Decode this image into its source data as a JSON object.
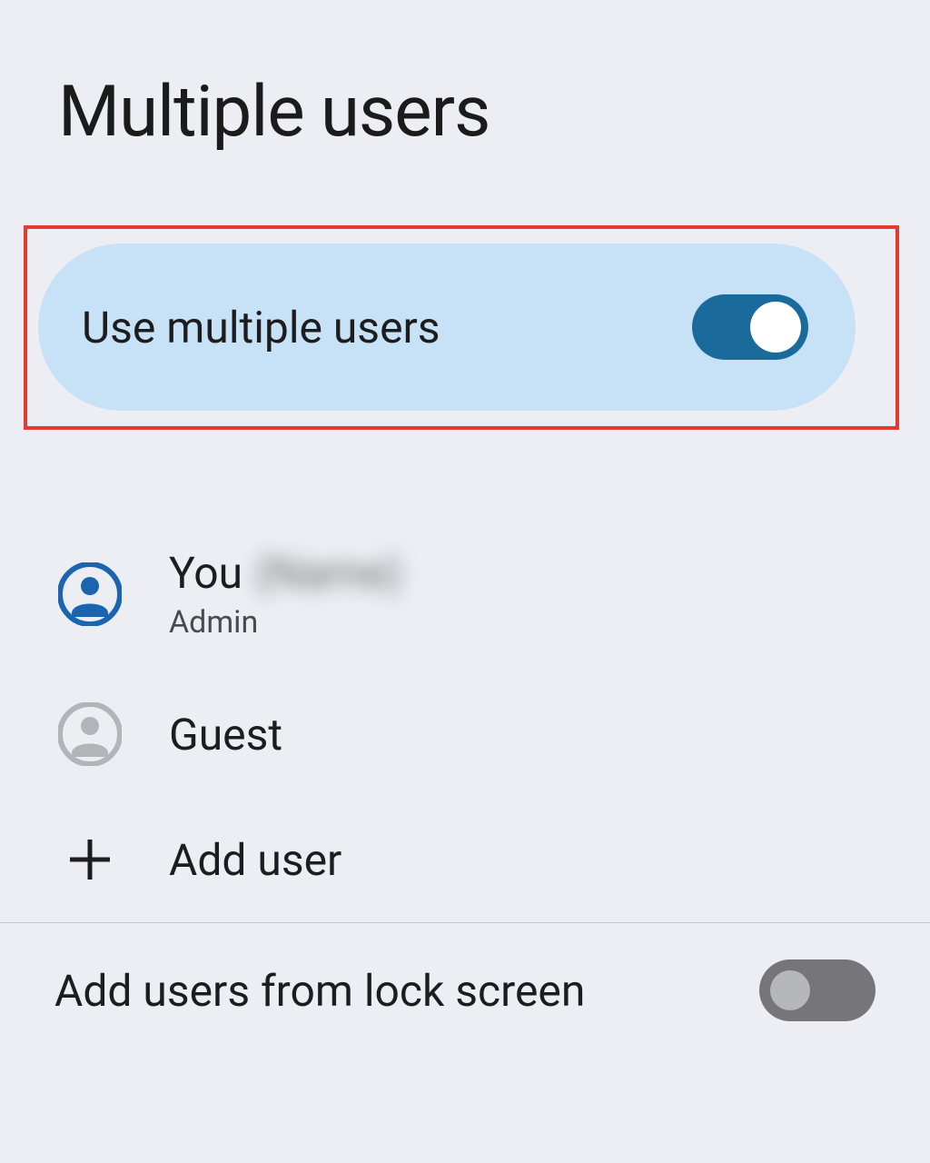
{
  "page": {
    "title": "Multiple users"
  },
  "toggle_card": {
    "label": "Use multiple users",
    "enabled": true
  },
  "users": [
    {
      "title_prefix": "You",
      "title_name_hidden": "(Name)",
      "subtitle": "Admin",
      "icon": "user-filled"
    },
    {
      "title": "Guest",
      "icon": "user-outline"
    }
  ],
  "add_user": {
    "label": "Add user"
  },
  "lock_screen": {
    "label": "Add users from lock screen",
    "enabled": false
  },
  "colors": {
    "highlight_border": "#e33b2e",
    "card_bg": "#c7e1f6",
    "switch_on": "#1a6b9c",
    "switch_off": "#75757a"
  }
}
